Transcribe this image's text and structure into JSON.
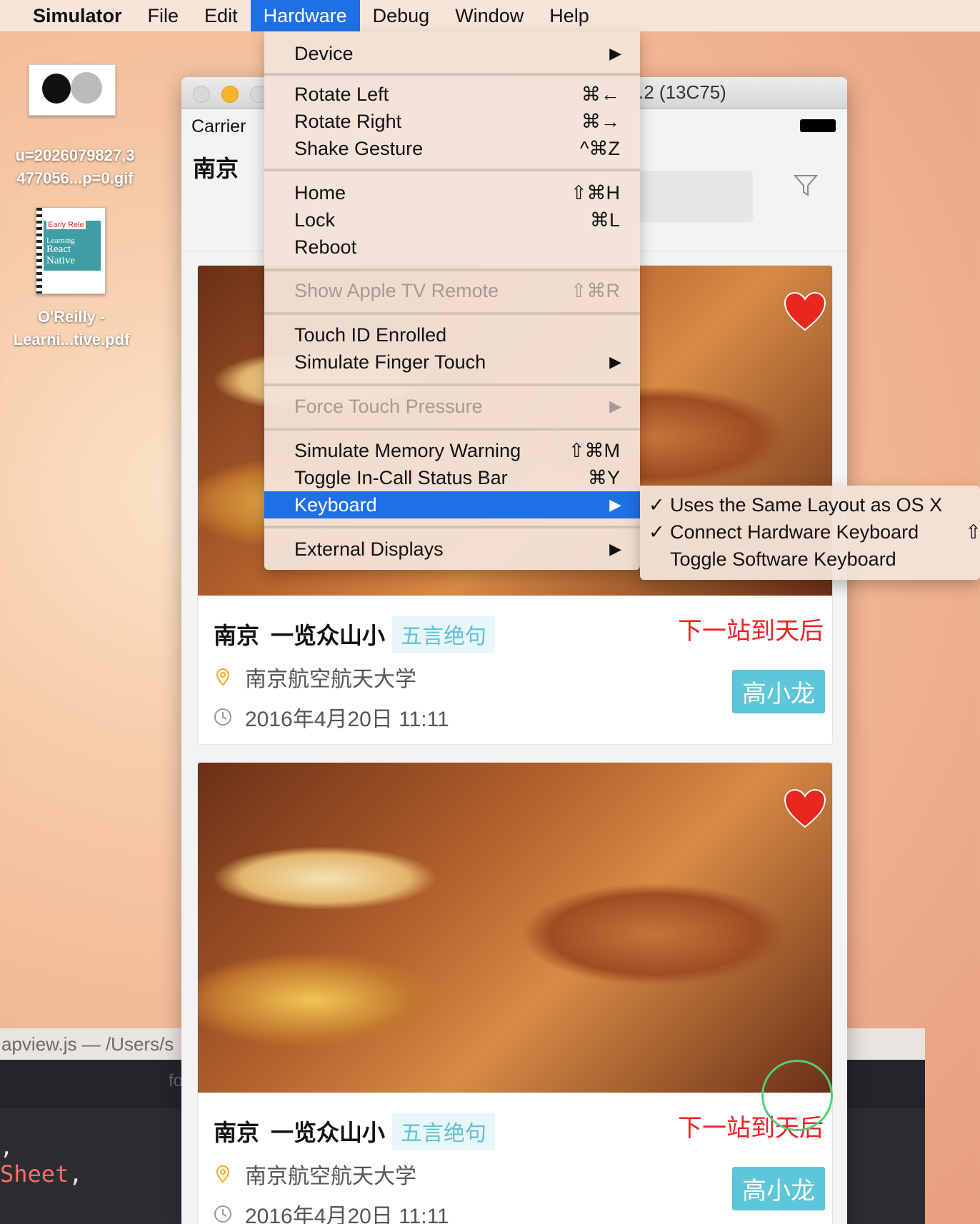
{
  "menubar": {
    "apple": "",
    "items": [
      {
        "label": "Simulator"
      },
      {
        "label": "File"
      },
      {
        "label": "Edit"
      },
      {
        "label": "Hardware"
      },
      {
        "label": "Debug"
      },
      {
        "label": "Window"
      },
      {
        "label": "Help"
      }
    ]
  },
  "desktop": {
    "icon1": {
      "line1": "u=2026079827,3",
      "line2": "477056...p=0.gif"
    },
    "icon2": {
      "line1": "O'Reilly -",
      "line2": "Learni...tive.pdf",
      "cover_text": [
        "Early Rele",
        "Learning",
        "React",
        "Native"
      ]
    }
  },
  "editor": {
    "title": "apview.js — /Users/s",
    "tab_text": "fo",
    "code1": ",",
    "code2": "Sheet",
    ",code2_suffix": ","
  },
  "simulator": {
    "window_title": ".2 (13C75)",
    "carrier": "Carrier",
    "nav_title": "南京",
    "cards": [
      {
        "title": "南京",
        "subtitle": "一览众山小",
        "tag": "五言绝句",
        "right_text": "下一站到天后",
        "location": "南京航空航天大学",
        "datetime": "2016年4月20日 11:11",
        "author": "高小龙"
      },
      {
        "title": "南京",
        "subtitle": "一览众山小",
        "tag": "五言绝句",
        "right_text": "下一站到天后",
        "location": "南京航空航天大学",
        "datetime": "2016年4月20日 11:11",
        "author": "高小龙"
      }
    ]
  },
  "hardware_menu": {
    "items": [
      {
        "label": "Device",
        "shortcut": "",
        "submenu": true,
        "disabled": false
      },
      {
        "label": "Rotate Left",
        "shortcut": "⌘←"
      },
      {
        "label": "Rotate Right",
        "shortcut": "⌘→"
      },
      {
        "label": "Shake Gesture",
        "shortcut": "^⌘Z"
      },
      {
        "label": "Home",
        "shortcut": "⇧⌘H"
      },
      {
        "label": "Lock",
        "shortcut": "⌘L"
      },
      {
        "label": "Reboot",
        "shortcut": ""
      },
      {
        "label": "Show Apple TV Remote",
        "shortcut": "⇧⌘R",
        "disabled": true
      },
      {
        "label": "Touch ID Enrolled",
        "shortcut": ""
      },
      {
        "label": "Simulate Finger Touch",
        "shortcut": "",
        "submenu": true
      },
      {
        "label": "Force Touch Pressure",
        "shortcut": "",
        "submenu": true,
        "disabled": true
      },
      {
        "label": "Simulate Memory Warning",
        "shortcut": "⇧⌘M"
      },
      {
        "label": "Toggle In-Call Status Bar",
        "shortcut": "⌘Y"
      },
      {
        "label": "Keyboard",
        "shortcut": "",
        "submenu": true,
        "selected": true
      },
      {
        "label": "External Displays",
        "shortcut": "",
        "submenu": true
      }
    ],
    "arrow": "▶"
  },
  "keyboard_submenu": {
    "items": [
      {
        "label": "Uses the Same Layout as OS X",
        "checked": true
      },
      {
        "label": "Connect Hardware Keyboard",
        "checked": true,
        "shortcut_partial": "⇧"
      },
      {
        "label": "Toggle Software Keyboard",
        "checked": false
      }
    ],
    "check": "✓"
  },
  "colors": {
    "accent": "#1f6fe5",
    "tag_bg": "#e7f6f9",
    "tag_fg": "#5fbfd6",
    "author_bg": "#5ec6d9",
    "red_text": "#f02222",
    "heart": "#e8281e"
  }
}
